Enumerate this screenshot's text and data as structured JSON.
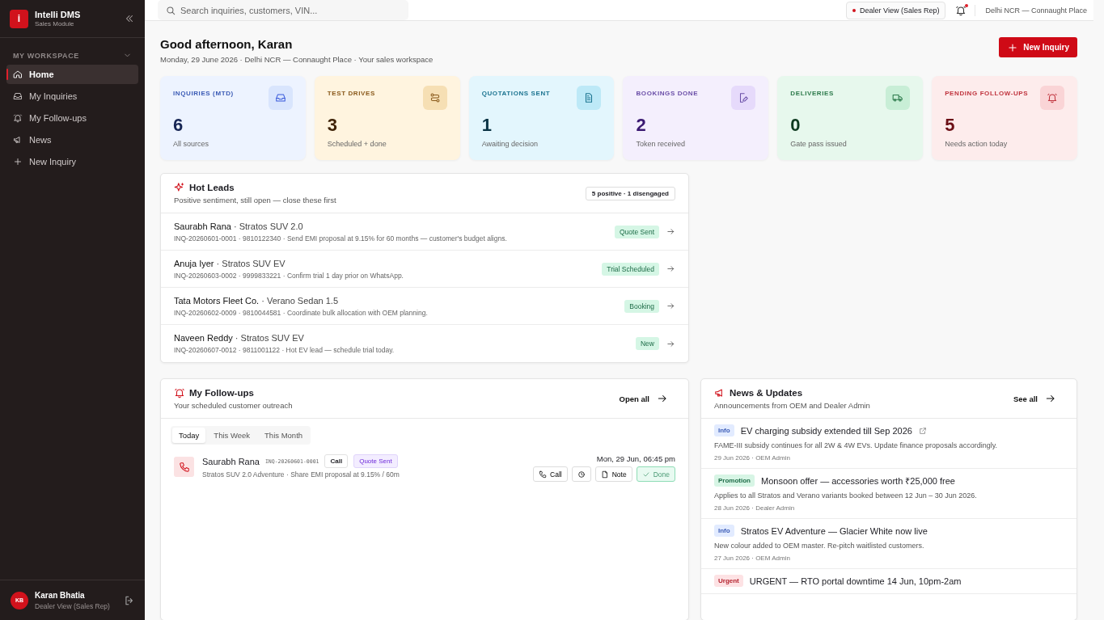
{
  "sidebar": {
    "brand": {
      "logo": "i",
      "name": "Intelli DMS",
      "subtitle": "Sales Module"
    },
    "section": {
      "title": "MY WORKSPACE",
      "expanded": true
    },
    "items": [
      {
        "label": "Home",
        "selected": true
      },
      {
        "label": "My Inquiries",
        "selected": false
      },
      {
        "label": "My Follow-ups",
        "selected": false
      },
      {
        "label": "News",
        "selected": false
      },
      {
        "label": "New Inquiry",
        "selected": false
      }
    ],
    "user": {
      "initials": "KB",
      "name": "Karan Bhatia",
      "role": "Dealer View (Sales Rep)"
    }
  },
  "header": {
    "search": {
      "placeholder": "Search inquiries, customers, VIN..."
    },
    "view_badge": {
      "label": "Dealer View (Sales Rep)",
      "live": true
    },
    "notifications": {
      "unread": true
    },
    "location": "Delhi NCR — Connaught Place"
  },
  "greeting": {
    "title": "Good afternoon, Karan",
    "subtitle": "Monday, 29 June 2026 · Delhi NCR — Connaught Place · Your sales workspace",
    "action": "New Inquiry"
  },
  "stats": [
    {
      "label": "INQUIRIES (MTD)",
      "value": "6",
      "note": "All sources"
    },
    {
      "label": "TEST DRIVES",
      "value": "3",
      "note": "Scheduled + done"
    },
    {
      "label": "QUOTATIONS SENT",
      "value": "1",
      "note": "Awaiting decision"
    },
    {
      "label": "BOOKINGS DONE",
      "value": "2",
      "note": "Token received"
    },
    {
      "label": "DELIVERIES",
      "value": "0",
      "note": "Gate pass issued"
    },
    {
      "label": "PENDING FOLLOW-UPS",
      "value": "5",
      "note": "Needs action today"
    }
  ],
  "hot_leads": {
    "title": "Hot Leads",
    "subtitle": "Positive sentiment, still open — close these first",
    "badge": "5 positive · 1 disengaged",
    "rows": [
      {
        "name": "Saurabh Rana",
        "model": "· Stratos SUV 2.0",
        "meta": "INQ-20260601-0001 · 9810122340 · Send EMI proposal at 9.15% for 60 months — customer's budget aligns.",
        "status": "Quote Sent"
      },
      {
        "name": "Anuja Iyer",
        "model": "· Stratos SUV EV",
        "meta": "INQ-20260603-0002 · 9999833221 · Confirm trial 1 day prior on WhatsApp.",
        "status": "Trial Scheduled"
      },
      {
        "name": "Tata Motors Fleet Co.",
        "model": "· Verano Sedan 1.5",
        "meta": "INQ-20260602-0009 · 9810044581 · Coordinate bulk allocation with OEM planning.",
        "status": "Booking"
      },
      {
        "name": "Naveen Reddy",
        "model": "· Stratos SUV EV",
        "meta": "INQ-20260607-0012 · 9811001122 · Hot EV lead — schedule trial today.",
        "status": "New"
      }
    ]
  },
  "followups": {
    "title": "My Follow-ups",
    "subtitle": "Your scheduled customer outreach",
    "action": "Open all",
    "tabs": [
      {
        "label": "Today",
        "selected": true
      },
      {
        "label": "This Week",
        "selected": false
      },
      {
        "label": "This Month",
        "selected": false
      }
    ],
    "items": [
      {
        "name": "Saurabh Rana",
        "inquiry_id": "INQ-20260601-0001",
        "channel": "Call",
        "stage": "Quote Sent",
        "detail": "Stratos SUV 2.0 Adventure · Share EMI proposal at 9.15% / 60m",
        "due": "Mon, 29 Jun, 06:45 pm",
        "actions": [
          {
            "kind": "call",
            "label": "Call"
          },
          {
            "kind": "snooze"
          },
          {
            "kind": "note",
            "label": "Note"
          },
          {
            "kind": "done",
            "label": "Done"
          }
        ]
      }
    ]
  },
  "news": {
    "title": "News & Updates",
    "subtitle": "Announcements from OEM and Dealer Admin",
    "action": "See all",
    "items": [
      {
        "tag": "Info",
        "kind": "info",
        "title": "EV charging subsidy extended till Sep 2026",
        "external": true,
        "body": "FAME-III subsidy continues for all 2W & 4W EVs. Update finance proposals accordingly.",
        "meta": "29 Jun 2026 · OEM Admin"
      },
      {
        "tag": "Promotion",
        "kind": "promotion",
        "title": "Monsoon offer — accessories worth ₹25,000 free",
        "external": false,
        "body": "Applies to all Stratos and Verano variants booked between 12 Jun – 30 Jun 2026.",
        "meta": "28 Jun 2026 · Dealer Admin"
      },
      {
        "tag": "Info",
        "kind": "info",
        "title": "Stratos EV Adventure — Glacier White now live",
        "external": false,
        "body": "New colour added to OEM master. Re-pitch waitlisted customers.",
        "meta": "27 Jun 2026 · OEM Admin"
      },
      {
        "tag": "Urgent",
        "kind": "urgent",
        "title": "URGENT — RTO portal downtime 14 Jun, 10pm-2am",
        "external": false
      }
    ]
  }
}
